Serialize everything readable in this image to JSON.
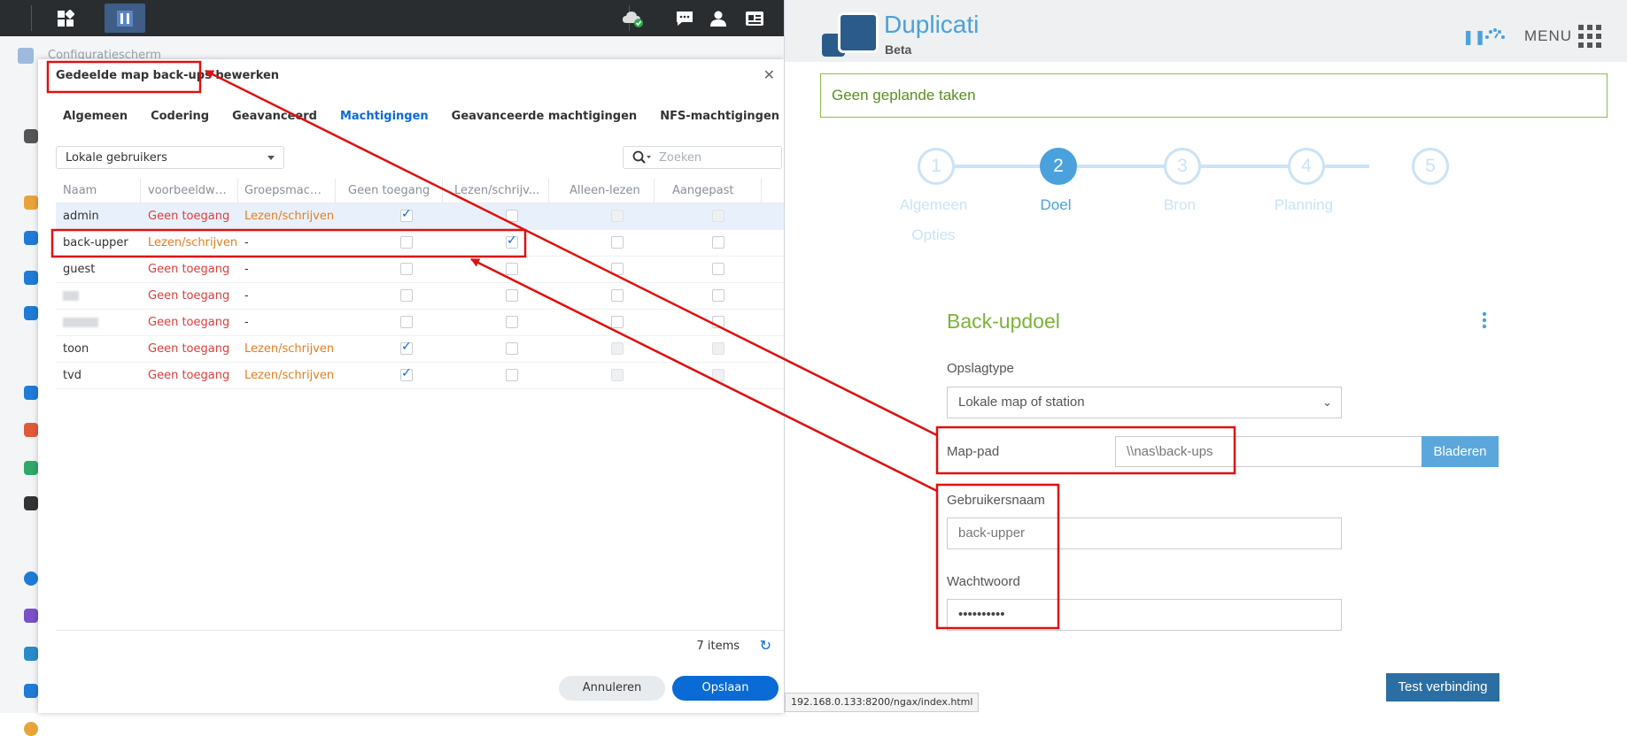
{
  "taskbar": {
    "apps_icon": "grid-icon",
    "panel_icon": "control-panel-icon"
  },
  "control_panel": {
    "title": "Configuratiescherm",
    "dialog": {
      "title": "Gedeelde map back-ups bewerken",
      "tabs": [
        "Algemeen",
        "Codering",
        "Geavanceerd",
        "Machtigingen",
        "Geavanceerde machtigingen",
        "NFS-machtigingen"
      ],
      "active_tab": "Machtigingen",
      "user_type": "Lokale gebruikers",
      "search_placeholder": "Zoeken",
      "columns": [
        "Naam",
        "voorbeeldwee...",
        "Groepsmachti...",
        "Geen toegang",
        "Lezen/schrijv...",
        "Alleen-lezen",
        "Aangepast"
      ],
      "rows": [
        {
          "name": "admin",
          "preview": "Geen toegang",
          "group": "Lezen/schrijven",
          "no_access": true,
          "read_write": false,
          "read_only": false,
          "custom": false
        },
        {
          "name": "back-upper",
          "preview": "Lezen/schrijven",
          "group": "-",
          "no_access": false,
          "read_write": true,
          "read_only": false,
          "custom": false
        },
        {
          "name": "guest",
          "preview": "Geen toegang",
          "group": "-",
          "no_access": false,
          "read_write": false,
          "read_only": false,
          "custom": false
        },
        {
          "name": "",
          "preview": "Geen toegang",
          "group": "-",
          "no_access": false,
          "read_write": false,
          "read_only": false,
          "custom": false
        },
        {
          "name": "",
          "preview": "Geen toegang",
          "group": "-",
          "no_access": false,
          "read_write": false,
          "read_only": false,
          "custom": false
        },
        {
          "name": "toon",
          "preview": "Geen toegang",
          "group": "Lezen/schrijven",
          "no_access": true,
          "read_write": false,
          "read_only": false,
          "custom": false
        },
        {
          "name": "tvd",
          "preview": "Geen toegang",
          "group": "Lezen/schrijven",
          "no_access": true,
          "read_write": false,
          "read_only": false,
          "custom": false
        }
      ],
      "item_count": "7 items",
      "cancel_label": "Annuleren",
      "save_label": "Opslaan"
    }
  },
  "duplicati": {
    "name": "Duplicati",
    "edition": "Beta",
    "menu_label": "MENU",
    "status": "Geen geplande taken",
    "steps": [
      {
        "num": "1",
        "label": "Algemeen",
        "label2": "Opties"
      },
      {
        "num": "2",
        "label": "Doel"
      },
      {
        "num": "3",
        "label": "Bron"
      },
      {
        "num": "4",
        "label": "Planning"
      },
      {
        "num": "5",
        "label": ""
      }
    ],
    "active_step": 2,
    "form": {
      "title": "Back-updoel",
      "storage_type_label": "Opslagtype",
      "storage_type_value": "Lokale map of station",
      "path_label": "Map-pad",
      "path_value": "\\\\nas\\back-ups",
      "browse_label": "Bladeren",
      "username_label": "Gebruikersnaam",
      "username_value": "back-upper",
      "password_label": "Wachtwoord",
      "password_value": "••••••••••",
      "test_label": "Test verbinding"
    },
    "statusbar_url": "192.168.0.133:8200/ngax/index.html"
  },
  "colors": {
    "accent_blue": "#0a6ad6",
    "duplicati_blue": "#4aa1dc",
    "annotation_red": "#e01010",
    "green": "#7db33a"
  }
}
